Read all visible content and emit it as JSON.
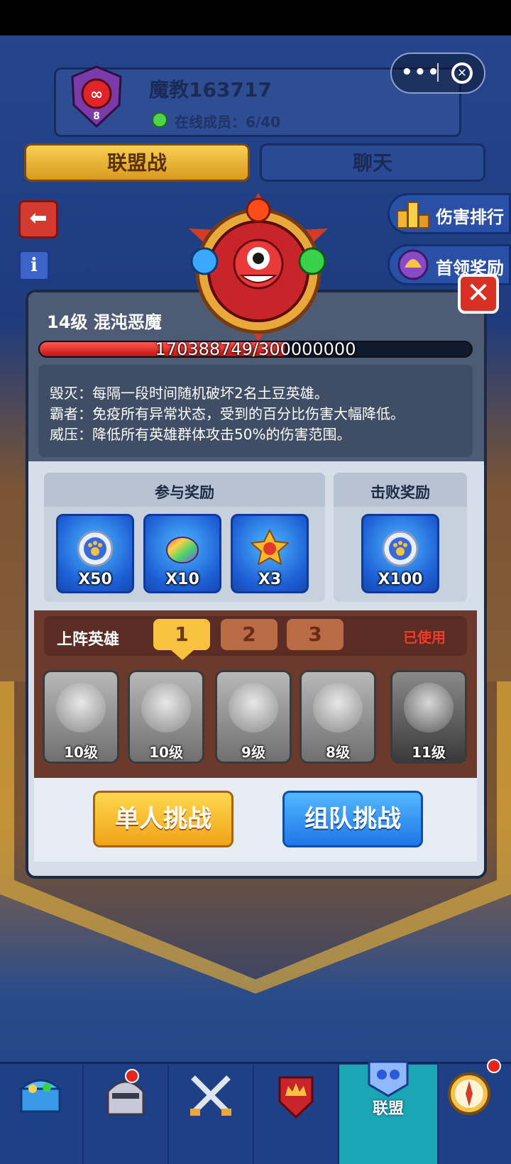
{
  "guild": {
    "name": "魔教163717",
    "level": "8",
    "online_label": "在线成员：6/40"
  },
  "mini_program": {
    "more": "•••",
    "close": "⊗"
  },
  "tabs": [
    {
      "label": "联盟战",
      "active": true
    },
    {
      "label": "聊天",
      "active": false
    }
  ],
  "side_buttons": [
    {
      "label": "伤害排行",
      "icon": "ranking-podium-icon"
    },
    {
      "label": "首领奖励",
      "icon": "boss-reward-icon"
    }
  ],
  "boss": {
    "title": "14级  混沌恶魔",
    "hp_text": "170388749/300000000",
    "hp_current": 170388749,
    "hp_max": 300000000,
    "abilities": [
      "毁灭：每隔一段时间随机破坏2名土豆英雄。",
      "霸者：免疫所有异常状态，受到的百分比伤害大幅降低。",
      "威压：降低所有英雄群体攻击50%的伤害范围。"
    ]
  },
  "rewards": {
    "participate_label": "参与奖励",
    "defeat_label": "击败奖励",
    "participate": [
      {
        "icon": "paw-coin-icon",
        "count": "X50"
      },
      {
        "icon": "rainbow-bean-icon",
        "count": "X10"
      },
      {
        "icon": "fist-badge-icon",
        "count": "X3"
      }
    ],
    "defeat": [
      {
        "icon": "paw-coin-icon",
        "count": "X100"
      }
    ]
  },
  "lineup": {
    "title": "上阵英雄",
    "tabs": [
      "1",
      "2",
      "3"
    ],
    "active_tab": 0,
    "status": "已使用",
    "heroes": [
      {
        "level": "10级"
      },
      {
        "level": "10级"
      },
      {
        "level": "9级"
      },
      {
        "level": "8级"
      },
      {
        "level": "11级"
      }
    ]
  },
  "actions": {
    "solo": "单人挑战",
    "team": "组队挑战"
  },
  "nav": {
    "items": [
      "chest-icon",
      "knight-helmet-icon",
      "crossed-swords-icon",
      "crown-shield-icon",
      "alliance-icon",
      "compass-icon"
    ],
    "active_label": "联盟"
  },
  "colors": {
    "hp_fill": "#e3221c",
    "accent_gold": "#f7c23f",
    "status_red": "#f23a2a",
    "nav_active": "#1aa6b5"
  }
}
